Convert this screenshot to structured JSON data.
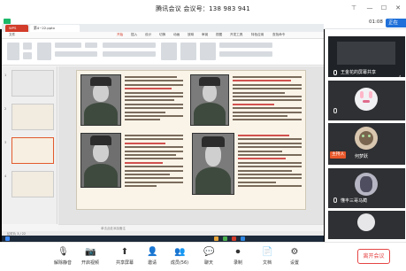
{
  "window": {
    "title": "腾讯会议 会议号：138 983 941",
    "timer": "01:08",
    "signal_label": "正在"
  },
  "ppt": {
    "tabs": [
      "WPS",
      "第4~22.pptx"
    ],
    "menu": [
      "文件",
      "开始",
      "插入",
      "设计",
      "切换",
      "动画",
      "放映",
      "审阅",
      "视图",
      "开发工具",
      "特色应用",
      "查找命令"
    ],
    "slide_count": [
      "1",
      "2",
      "3",
      "4"
    ],
    "notes_placeholder": "单击此处添加备注",
    "status": "幻灯片 3 / 22"
  },
  "participants": {
    "screen_share_label": "王金花的屏幕共享",
    "list": [
      {
        "name": "王金花的屏幕共享",
        "role": ""
      },
      {
        "name": "何梦跃",
        "role": "主持人"
      },
      {
        "name": "懂丰三哥马蔺",
        "role": ""
      }
    ],
    "host_badge": "主持人"
  },
  "toolbar": {
    "items": [
      {
        "label": "解除静音",
        "icon": "mic-muted-icon"
      },
      {
        "label": "开启视频",
        "icon": "video-off-icon"
      },
      {
        "label": "共享屏幕",
        "icon": "share-screen-icon"
      },
      {
        "label": "邀请",
        "icon": "invite-icon"
      },
      {
        "label": "成员(56)",
        "icon": "members-icon"
      },
      {
        "label": "聊天",
        "icon": "chat-icon"
      },
      {
        "label": "录制",
        "icon": "record-icon"
      },
      {
        "label": "文档",
        "icon": "document-icon"
      },
      {
        "label": "设置",
        "icon": "settings-icon"
      }
    ],
    "leave_label": "离开会议"
  },
  "colors": {
    "accent": "#1e6fd9",
    "leave": "#e54545",
    "host_badge": "#e7582a",
    "secure_shield": "#1db86a"
  }
}
